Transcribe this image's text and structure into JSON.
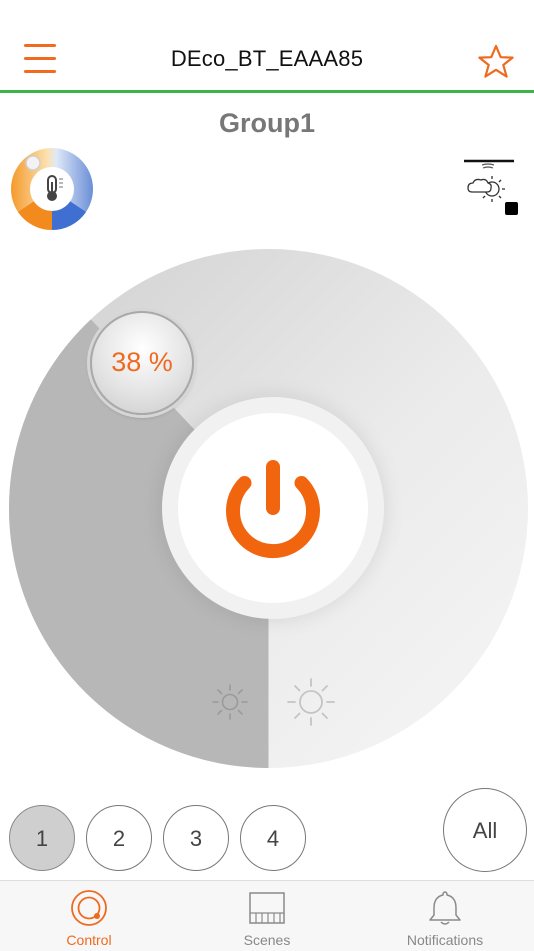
{
  "header": {
    "title": "DEco_BT_EAAA85"
  },
  "group_title": "Group1",
  "dial": {
    "brightness_label": "38 %",
    "brightness_value": 38
  },
  "channels": {
    "items": [
      "1",
      "2",
      "3",
      "4"
    ],
    "selected": "1",
    "all_label": "All"
  },
  "tabs": [
    {
      "label": "Control",
      "active": true
    },
    {
      "label": "Scenes",
      "active": false
    },
    {
      "label": "Notifications",
      "active": false
    }
  ],
  "colors": {
    "accent": "#ef6a1f",
    "divider": "#39b54a",
    "dial_dark": "#b4b4b4",
    "dial_light": "#efefef"
  },
  "icons": {
    "menu": "hamburger-icon",
    "favorite": "star-icon",
    "temperature": "color-temperature-wheel-icon",
    "weather": "weather-sensor-icon",
    "power": "power-icon",
    "sun_small": "sun-small-icon",
    "sun_large": "sun-large-icon",
    "control": "control-tab-icon",
    "scenes": "scenes-tab-icon",
    "notifications": "bell-icon"
  }
}
